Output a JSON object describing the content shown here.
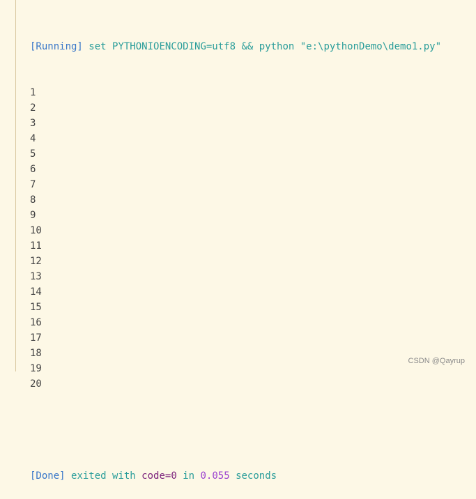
{
  "running_line": {
    "tag": "[Running]",
    "command": "set PYTHONIOENCODING=utf8 && python \"e:\\pythonDemo\\demo1.py\""
  },
  "output_lines": [
    "1",
    "2",
    "3",
    "4",
    "5",
    "6",
    "7",
    "8",
    "9",
    "10",
    "11",
    "12",
    "13",
    "14",
    "15",
    "16",
    "17",
    "18",
    "19",
    "20"
  ],
  "done_line": {
    "tag": "[Done]",
    "text1": "exited with",
    "code": "code=0",
    "text2": "in",
    "duration": "0.055",
    "text3": "seconds"
  },
  "watermark": "CSDN @Qayrup"
}
